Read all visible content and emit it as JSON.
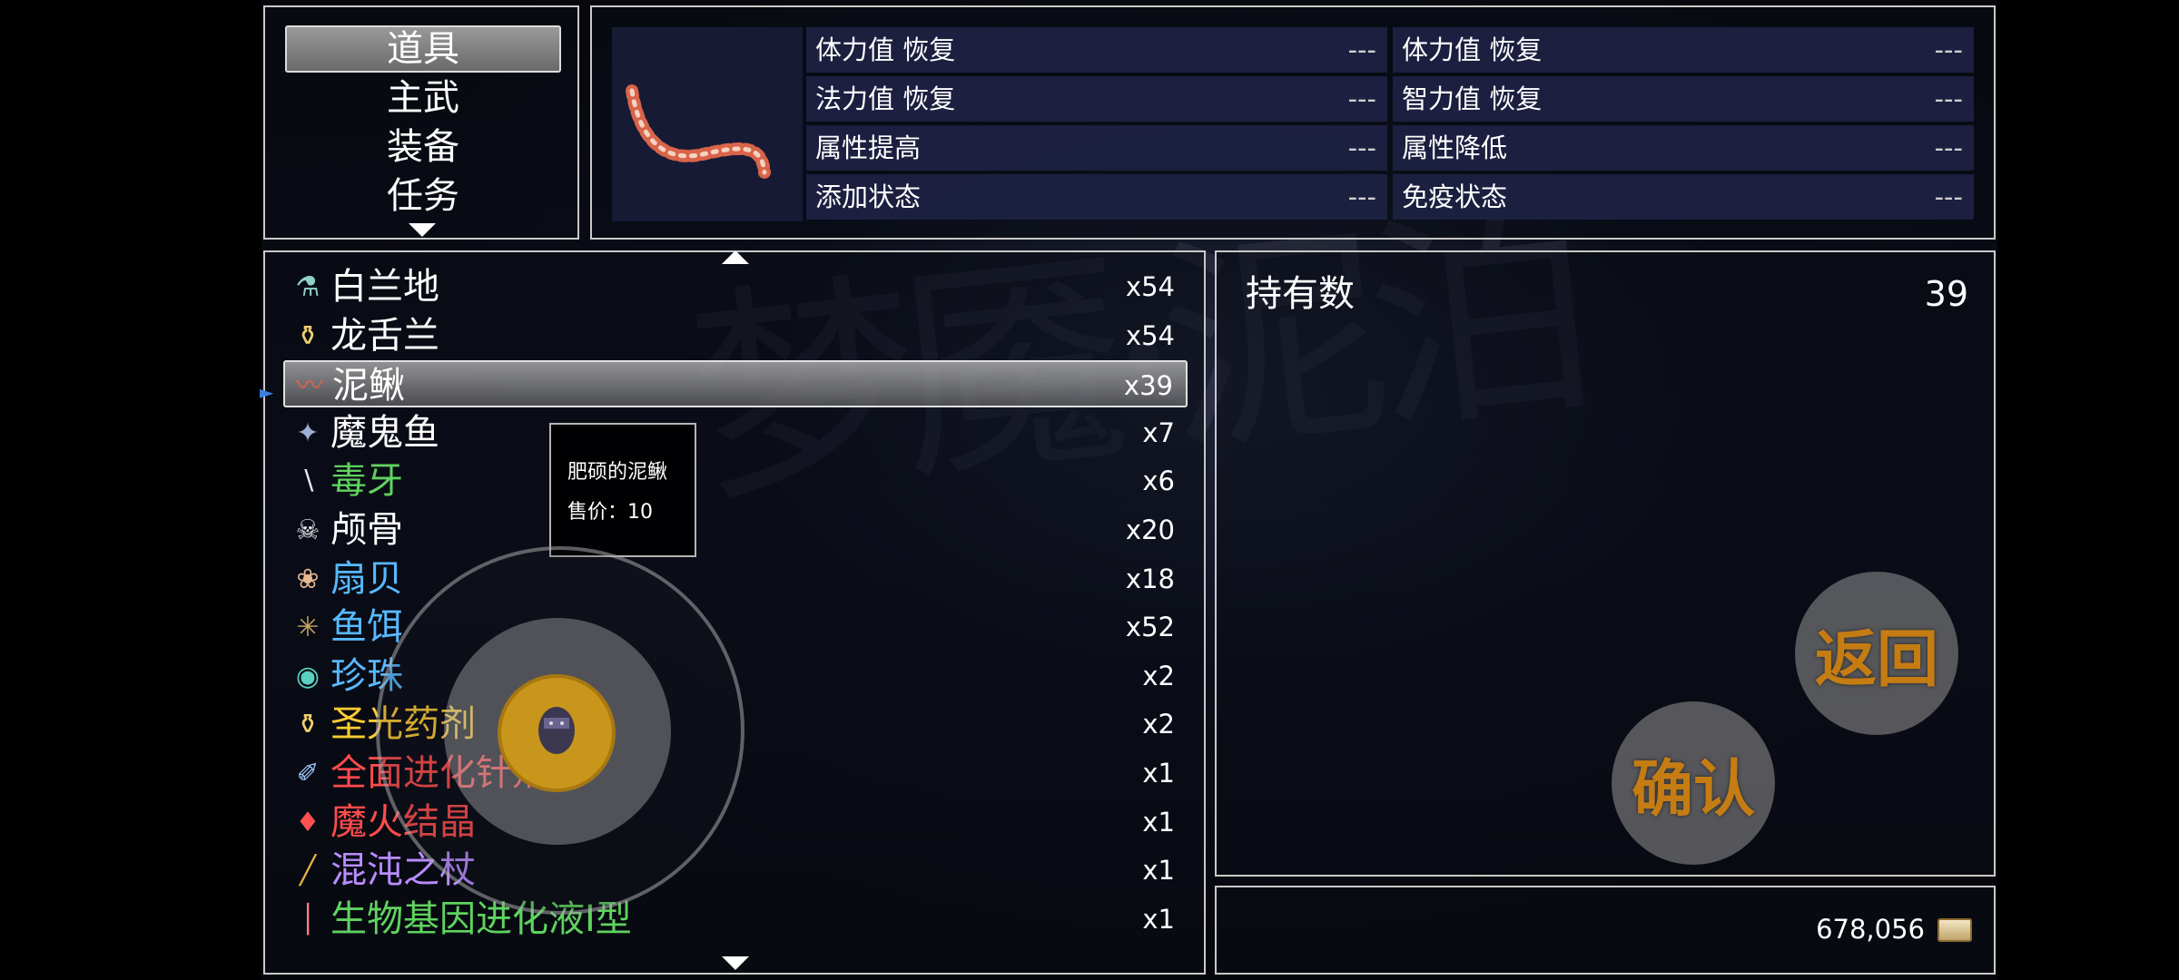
{
  "categories": [
    {
      "label": "道具",
      "selected": true
    },
    {
      "label": "主武",
      "selected": false
    },
    {
      "label": "装备",
      "selected": false
    },
    {
      "label": "任务",
      "selected": false
    }
  ],
  "stats": {
    "left": [
      {
        "label": "体力值 恢复",
        "value": "---"
      },
      {
        "label": "法力值 恢复",
        "value": "---"
      },
      {
        "label": "属性提高",
        "value": "---"
      },
      {
        "label": "添加状态",
        "value": "---"
      }
    ],
    "right": [
      {
        "label": "体力值 恢复",
        "value": "---"
      },
      {
        "label": "智力值 恢复",
        "value": "---"
      },
      {
        "label": "属性降低",
        "value": "---"
      },
      {
        "label": "免疫状态",
        "value": "---"
      }
    ]
  },
  "items": [
    {
      "name": "白兰地",
      "qty": "x54",
      "color": "#ffffff",
      "icon": "bottle-icon"
    },
    {
      "name": "龙舌兰",
      "qty": "x54",
      "color": "#ffffff",
      "icon": "potion-icon"
    },
    {
      "name": "泥鳅",
      "qty": "x39",
      "color": "#ffffff",
      "icon": "worm-icon",
      "selected": true
    },
    {
      "name": "魔鬼鱼",
      "qty": "x7",
      "color": "#ffffff",
      "icon": "fish-icon"
    },
    {
      "name": "毒牙",
      "qty": "x6",
      "color": "#5fd35f",
      "icon": "fang-icon"
    },
    {
      "name": "颅骨",
      "qty": "x20",
      "color": "#ffffff",
      "icon": "skull-icon"
    },
    {
      "name": "扇贝",
      "qty": "x18",
      "color": "#58b9ff",
      "icon": "shell-icon"
    },
    {
      "name": "鱼饵",
      "qty": "x52",
      "color": "#58b9ff",
      "icon": "bait-icon"
    },
    {
      "name": "珍珠",
      "qty": "x2",
      "color": "#58b9ff",
      "icon": "pearl-icon"
    },
    {
      "name": "圣光药剂",
      "qty": "x2",
      "color": "#ffcc33",
      "icon": "potion-icon"
    },
    {
      "name": "全面进化针剂",
      "qty": "x1",
      "color": "#ff4b4b",
      "icon": "syringe-icon"
    },
    {
      "name": "魔火结晶",
      "qty": "x1",
      "color": "#ff4b4b",
      "icon": "crystal-icon"
    },
    {
      "name": "混沌之杖",
      "qty": "x1",
      "color": "#b98cff",
      "icon": "staff-icon"
    },
    {
      "name": "生物基因进化液I型",
      "qty": "x1",
      "color": "#5fd35f",
      "icon": "vial-icon"
    }
  ],
  "tooltip": {
    "line1": "肥硕的泥鳅",
    "line2": "售价：10"
  },
  "holding": {
    "label": "持有数",
    "value": "39"
  },
  "gold": {
    "value": "678,056",
    "icon": "gold-icon"
  },
  "buttons": {
    "back": "返回",
    "confirm": "确认"
  }
}
